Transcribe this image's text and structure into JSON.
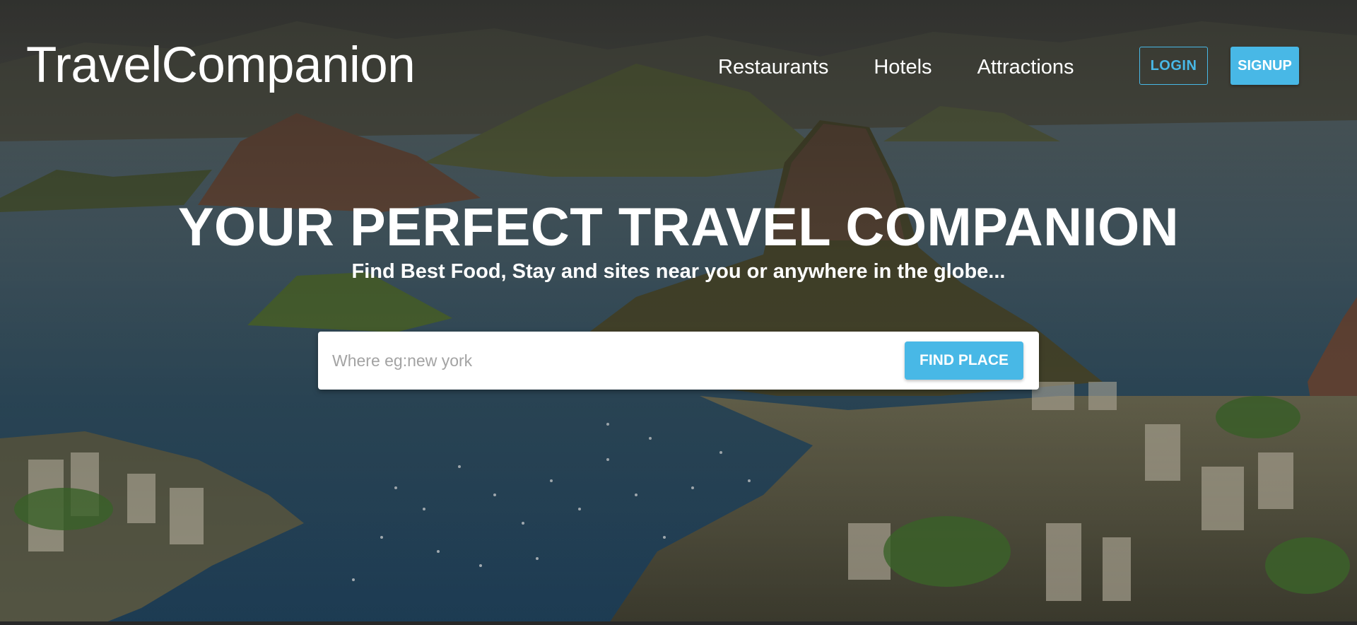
{
  "brand": {
    "name": "TravelCompanion"
  },
  "nav": {
    "items": [
      {
        "label": "Restaurants"
      },
      {
        "label": "Hotels"
      },
      {
        "label": "Attractions"
      }
    ],
    "login_label": "LOGIN",
    "signup_label": "SIGNUP"
  },
  "hero": {
    "headline": "YOUR PERFECT TRAVEL COMPANION",
    "subheadline": "Find Best Food, Stay and sites near you or anywhere in the globe..."
  },
  "search": {
    "placeholder": "Where eg:new york",
    "value": "",
    "button_label": "FIND PLACE"
  },
  "colors": {
    "accent": "#48b8e6",
    "text": "#ffffff",
    "placeholder": "#a3a3a3"
  }
}
